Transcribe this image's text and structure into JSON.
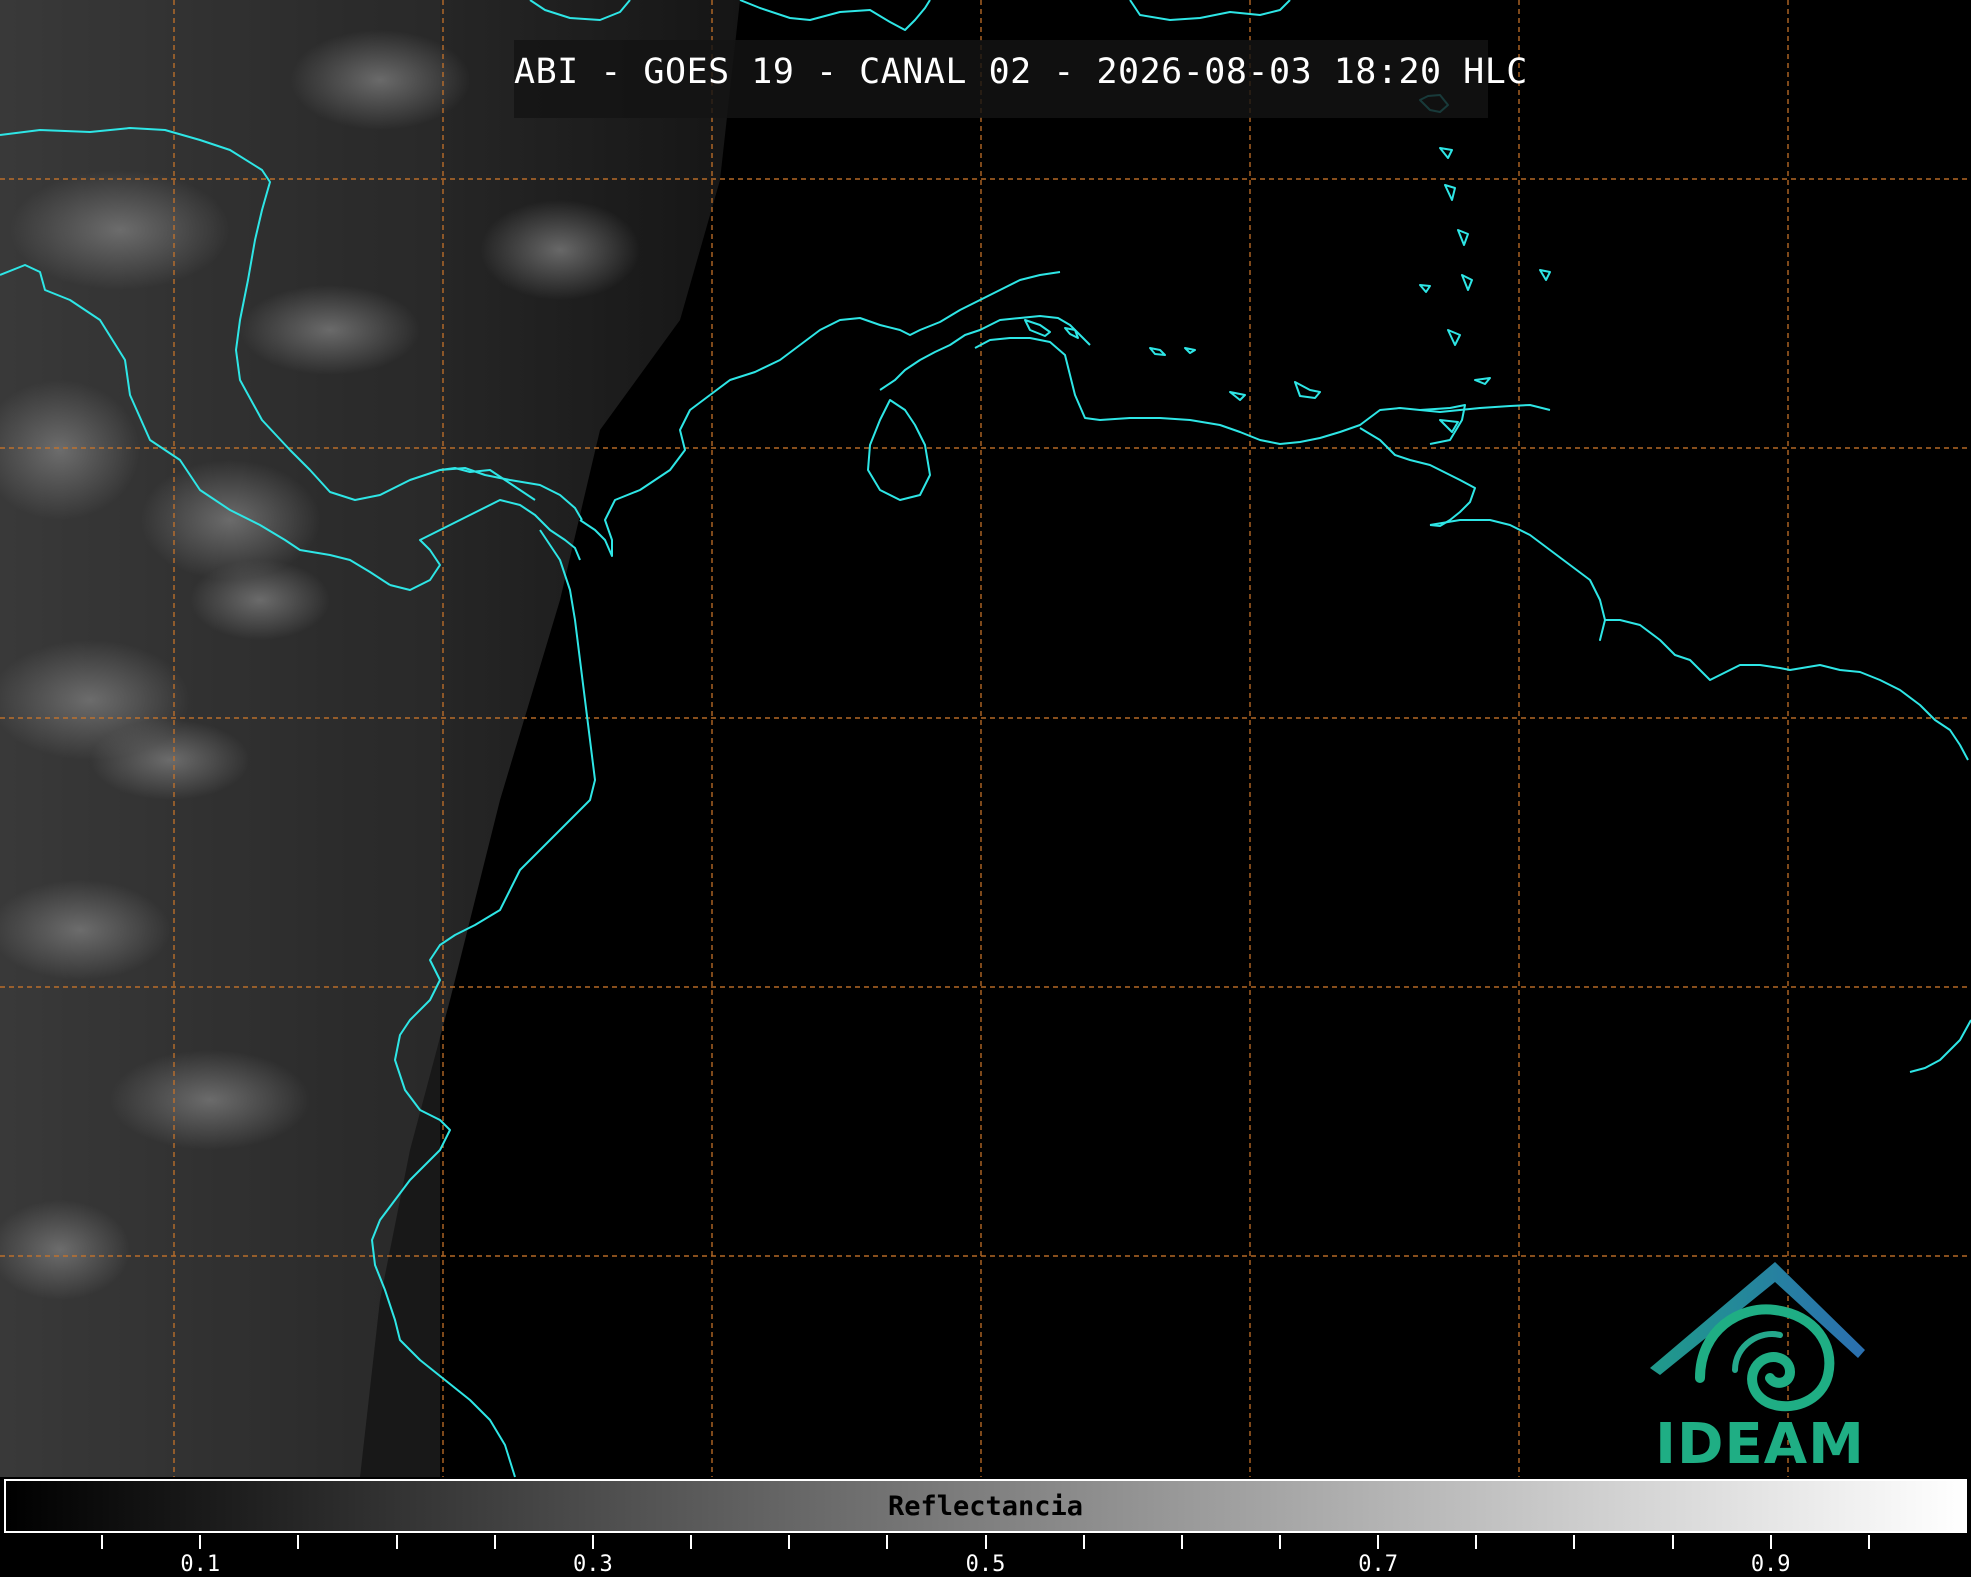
{
  "header": {
    "title": "ABI - GOES 19 - CANAL 02 - 2026-08-03 18:20 HLC"
  },
  "colorbar": {
    "label": "Reflectancia",
    "range": [
      0.0,
      1.0
    ],
    "colormap": [
      "#000000",
      "#ffffff"
    ],
    "major_ticks": [
      {
        "value": 0.1,
        "label": "0.1"
      },
      {
        "value": 0.3,
        "label": "0.3"
      },
      {
        "value": 0.5,
        "label": "0.5"
      },
      {
        "value": 0.7,
        "label": "0.7"
      },
      {
        "value": 0.9,
        "label": "0.9"
      }
    ],
    "minor_ticks": [
      0.05,
      0.15,
      0.2,
      0.25,
      0.35,
      0.4,
      0.45,
      0.55,
      0.6,
      0.65,
      0.75,
      0.8,
      0.85,
      0.95
    ]
  },
  "map": {
    "coastline_color": "#2ee6e6",
    "graticule_color": "#c8742a",
    "background_color": "#000000"
  },
  "logo": {
    "text": "IDEAM",
    "text_color": "#1fae84",
    "roof_colors": [
      "#1f9a8a",
      "#2b6fb0"
    ]
  }
}
